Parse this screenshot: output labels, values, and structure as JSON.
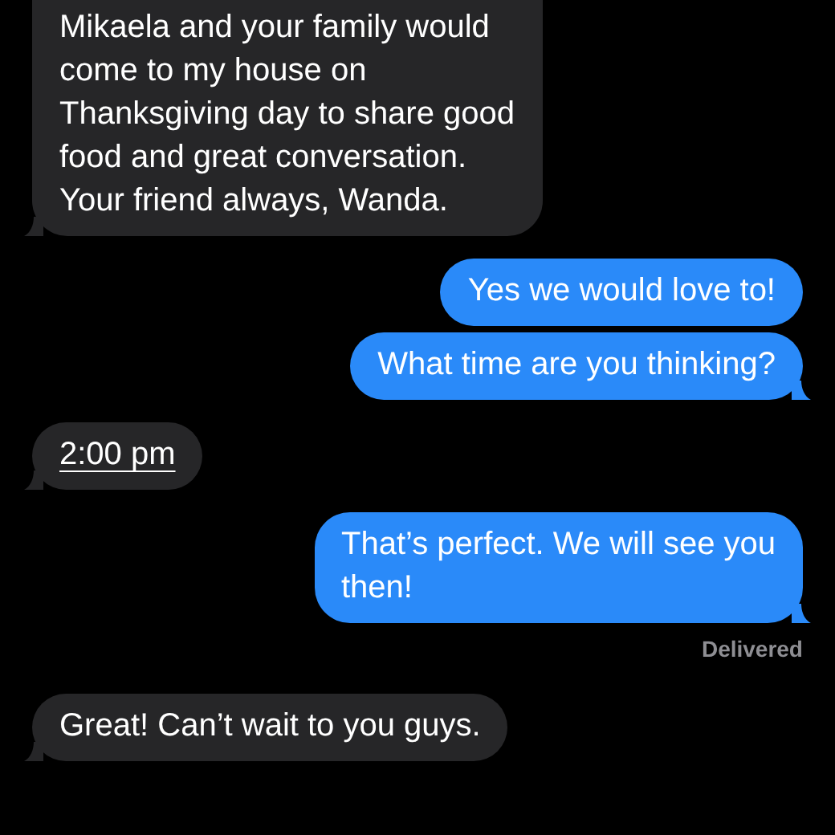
{
  "messages": [
    {
      "kind": "incoming",
      "text": "Mikaela and your family would\ncome to my house on\nThanksgiving day to share good\nfood and great conversation.\nYour friend always, Wanda.",
      "tail": true,
      "underlined": false,
      "cut_top": true
    },
    {
      "kind": "outgoing",
      "text": "Yes we would love to!",
      "tail": false,
      "underlined": false,
      "cut_top": false
    },
    {
      "kind": "outgoing",
      "text": "What time are you thinking?",
      "tail": true,
      "underlined": false,
      "cut_top": false
    },
    {
      "kind": "incoming",
      "text": "2:00 pm",
      "tail": true,
      "underlined": true,
      "cut_top": false
    },
    {
      "kind": "outgoing",
      "text": "That’s perfect. We will see you\nthen!",
      "tail": true,
      "underlined": false,
      "cut_top": false,
      "status": "Delivered"
    },
    {
      "kind": "incoming",
      "text": "Great! Can’t wait to you guys.",
      "tail": true,
      "underlined": false,
      "cut_top": false
    }
  ]
}
